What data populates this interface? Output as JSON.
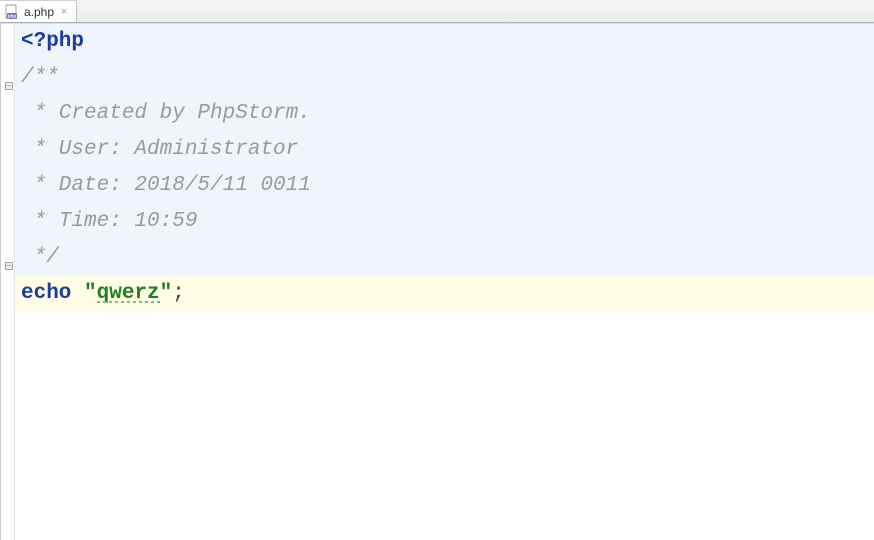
{
  "tab": {
    "filename": "a.php",
    "close_glyph": "×"
  },
  "code": {
    "line1_phptag": "<?php",
    "line2": "/**",
    "line3": " * Created by PhpStorm.",
    "line4": " * User: Administrator",
    "line5": " * Date: 2018/5/11 0011",
    "line6": " * Time: 10:59",
    "line7": " */",
    "line8_keyword": "echo",
    "line8_quote1": " \"",
    "line8_content": "qwerz",
    "line8_quote2": "\"",
    "line8_semi": ";"
  }
}
